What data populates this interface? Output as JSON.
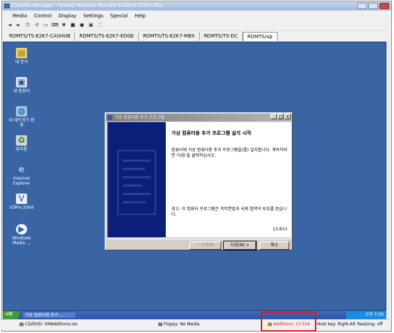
{
  "window": {
    "title": "Console Manager - Virtual Machine Remote Control Client Plus",
    "controls": [
      "minimize",
      "maximize",
      "close"
    ]
  },
  "menu": [
    "Media",
    "Control",
    "Display",
    "Settings",
    "Special",
    "Help"
  ],
  "toolbar": {
    "icons": [
      "back-icon",
      "forward-icon",
      "power-icon",
      "refresh-icon",
      "monitor-icon",
      "keyboard-icon",
      "settings-icon",
      "screen-icon",
      "record-icon",
      "ctrl-alt-del-icon",
      "fullscreen-icon"
    ]
  },
  "tabs": [
    "RDMTS/TS-E2K7-CASHUB",
    "RDMTS/TS-E2K7-EDGE",
    "RDMTS/TS-E2K7-MBX",
    "RDMTS/TS-DC",
    "RDMTS/xp"
  ],
  "active_tab": "RDMTS/xp",
  "desktop": {
    "background": "#3a65a5",
    "icons": [
      {
        "label": "내 문서",
        "icon": "my-documents-icon"
      },
      {
        "label": "내 컴퓨터",
        "icon": "my-computer-icon"
      },
      {
        "label": "내 네트워크 환경",
        "icon": "network-places-icon"
      },
      {
        "label": "휴지통",
        "icon": "recycle-bin-icon"
      },
      {
        "label": "Internet Explorer",
        "icon": "internet-explorer-icon"
      },
      {
        "label": "V3Pro 2004",
        "icon": "v3pro-icon"
      },
      {
        "label": "Windows Media ...",
        "icon": "windows-media-icon"
      }
    ]
  },
  "dialog": {
    "title": "가상 컴퓨터용 추가 프로그램",
    "heading": "가상 컴퓨터용 추가 프로그램 설치 시작",
    "body": "컴퓨터에 가상 컴퓨터용 추가 프로그램을(를) 설치합니다. 계속하려면 '다음'을 클릭하십시오.",
    "warning": "경고: 이 컴퓨터 프로그램은 저작권법과 국제 협약의 보호를 받습니다.",
    "version": "13.813",
    "buttons": {
      "back": "< 뒤로(B)",
      "next": "다음(N) >",
      "cancel": "취소"
    }
  },
  "taskbar": {
    "start_label": "시작",
    "task_item": "가상 컴퓨터용 추가 ...",
    "clock": "오후 7:29"
  },
  "status": {
    "cd_dvd": "CD/DVD: VMAdditions.iso",
    "floppy": "Floppy: No Media",
    "additions": "Additions: 13.554",
    "host_key": "Host key: Right-Alt",
    "resizing": "Resizing: off"
  },
  "colors": {
    "desktop": "#3a65a5",
    "highlight": "#e0151d",
    "additions_text": "#d42020",
    "wizard_side": "#0b1e78"
  }
}
